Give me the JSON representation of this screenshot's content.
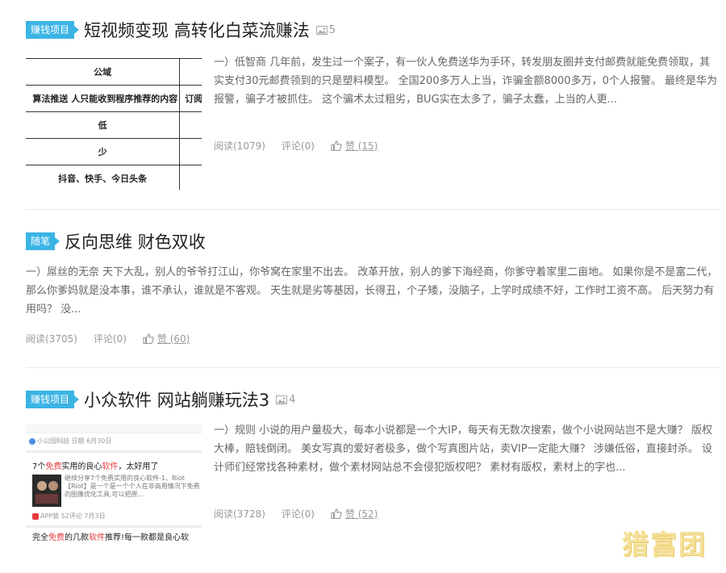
{
  "posts": [
    {
      "category": "赚钱项目",
      "title": "短视频变现 高转化白菜流赚法",
      "image_count": "5",
      "excerpt": "一）低智商 几年前，发生过一个案子，有一伙人免费送华为手环，转发朋友圈并支付邮费就能免费领取，其实支付30元邮费领到的只是塑料模型。 全国200多万人上当，诈骗金额8000多万，0个人报警。 最终是华为报警，骗子才被抓住。 这个骗术太过粗劣，BUG实在太多了，骗子太蠢，上当的人更...",
      "reads": "阅读(1079)",
      "comments": "评论(0)",
      "likes": "赞 (15)",
      "thumbnail_table": {
        "rows": [
          {
            "a": "公域",
            "b": ""
          },
          {
            "a": "算法推送 人只能收到程序推荐的内容",
            "b": "订阅"
          },
          {
            "a": "低",
            "b": ""
          },
          {
            "a": "少",
            "b": ""
          },
          {
            "a": "抖音、快手、今日头条",
            "b": ""
          }
        ]
      }
    },
    {
      "category": "随笔",
      "title": "反向思维 财色双收",
      "excerpt": "一）屌丝的无奈 天下大乱，别人的爷爷打江山，你爷窝在家里不出去。 改革开放，别人的爹下海经商，你爹守着家里二亩地。 如果你是不是富二代，那么你爹妈就是没本事，谁不承认，谁就是不客观。 天生就是劣等基因，长得丑，个子矮，没脑子，上学时成绩不好，工作时工资不高。 后天努力有用吗？ 没...",
      "reads": "阅读(3705)",
      "comments": "评论(0)",
      "likes": "赞 (60)"
    },
    {
      "category": "赚钱项目",
      "title": "小众软件 网站躺赚玩法3",
      "image_count": "4",
      "excerpt": "一）规则 小说的用户量极大，每本小说都是一个大IP，每天有无数次搜索，做个小说网站岂不是大赚？ 版权大棒，赔钱倒闭。 美女写真的爱好者极多，做个写真图片站，卖VIP一定能大赚？ 涉嫌低俗，直接封杀。 设计师们经常找各种素材，做个素材网站总不会侵犯版权吧？ 素材有版权，素材上的字也...",
      "reads": "阅读(3728)",
      "comments": "评论(0)",
      "likes": "赞 (52)",
      "thumbnail_feed": {
        "line1": "小公园科技  日期 6月30日",
        "title1_pre": "7个",
        "title1_hl": "免费",
        "title1_mid": "实用的良心",
        "title1_hl2": "软件",
        "title1_post": "，太好用了",
        "snippet": "继续分享7个免费实用的良心软件-1、Riot【Riot】是一个是一个个人在非商用情况下免费的图像优化工具,可以把原...",
        "meta2": "APP猿  52评论  7月3日",
        "title2_pre": "完全",
        "title2_hl": "免费",
        "title2_mid": "的几款",
        "title2_hl2": "软件",
        "title2_post": "推荐!每一款都是良心软"
      }
    }
  ],
  "watermark": "猎富团",
  "colors": {
    "badge": "#3bb4e5",
    "title": "#222222",
    "meta": "#999999",
    "highlight": "#e4393c"
  }
}
